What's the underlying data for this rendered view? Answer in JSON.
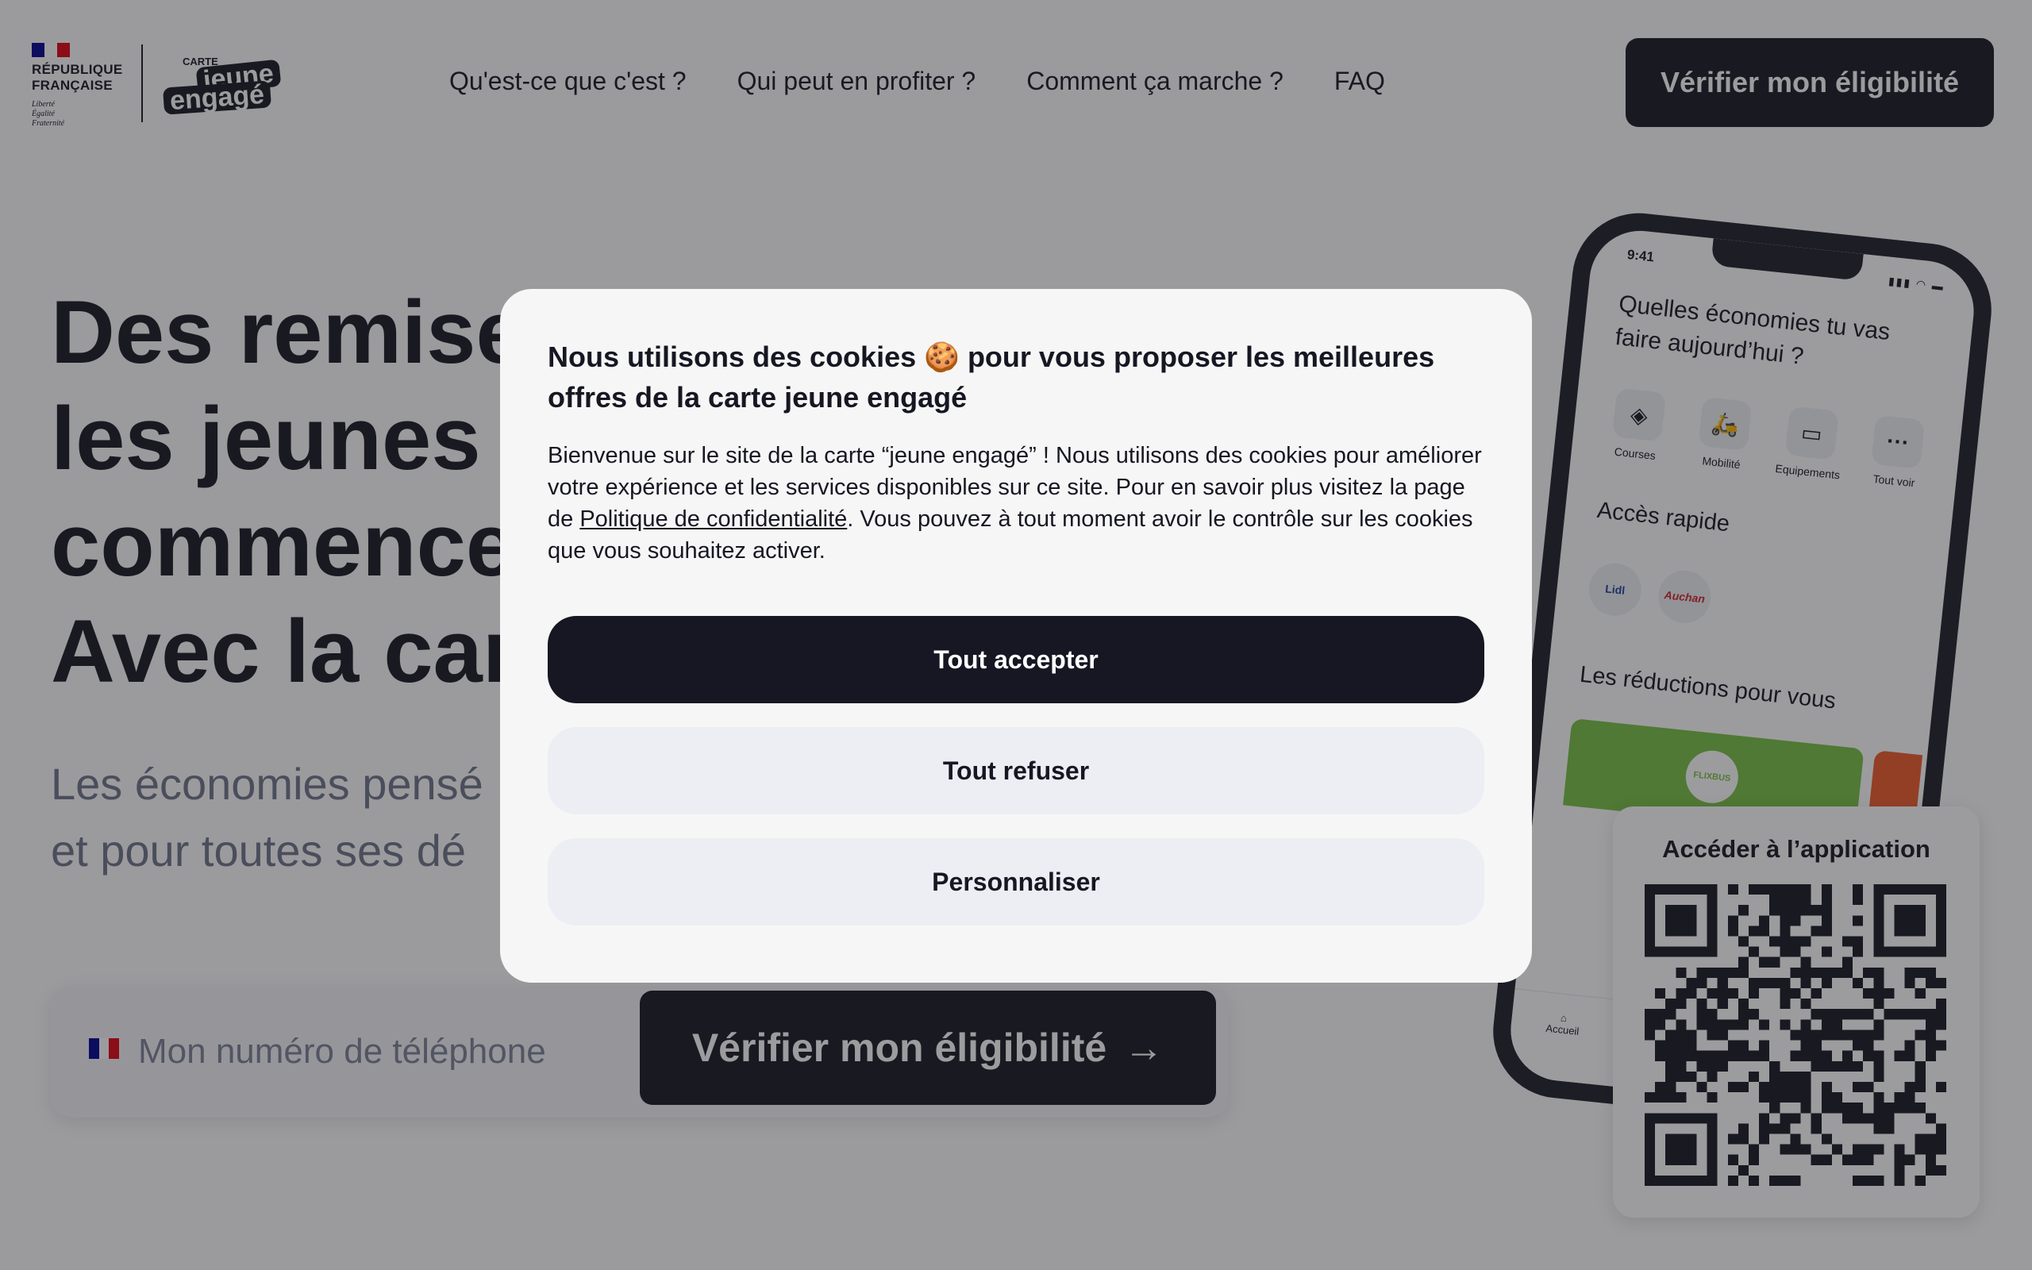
{
  "colors": {
    "primary_dark": "#161722",
    "flag_blue": "#000091",
    "flag_white": "#ffffff",
    "flag_red": "#e1000f"
  },
  "header": {
    "gov_name_line1": "RÉPUBLIQUE",
    "gov_name_line2": "FRANÇAISE",
    "gov_motto_line1": "Liberté",
    "gov_motto_line2": "Égalité",
    "gov_motto_line3": "Fraternité",
    "brand_small": "CARTE",
    "brand_word1": "jeune",
    "brand_word2": "engagé",
    "nav": [
      {
        "label": "Qu'est-ce que c'est ?"
      },
      {
        "label": "Qui peut en profiter ?"
      },
      {
        "label": "Comment ça marche ?"
      },
      {
        "label": "FAQ"
      }
    ],
    "cta_label": "Vérifier mon éligibilité"
  },
  "hero": {
    "title_line1": "Des remise",
    "title_line2": "les jeunes c",
    "title_line3": "commence",
    "title_line4": "Avec la car",
    "subtitle_line1": "Les économies pensé",
    "subtitle_line2": "et pour toutes ses dé",
    "phone_placeholder": "Mon numéro de téléphone",
    "cta_label": "Vérifier mon éligibilité",
    "cta_arrow": "→"
  },
  "phone_app": {
    "time": "9:41",
    "status": "▮▮▮ ◠ ▬",
    "title": "Quelles économies tu vas faire aujourd’hui ?",
    "categories": [
      {
        "label": "Courses",
        "icon": "◈"
      },
      {
        "label": "Mobilité",
        "icon": "🛵"
      },
      {
        "label": "Equipements",
        "icon": "▭"
      },
      {
        "label": "Tout voir",
        "icon": "···"
      }
    ],
    "quick_access_title": "Accès rapide",
    "quick_access": [
      "Lidl",
      "Auchan"
    ],
    "reductions_title": "Les réductions pour vous",
    "card_brand": "FLIXBUS",
    "nav_home": "Accueil"
  },
  "qr": {
    "title": "Accéder à l’application"
  },
  "cookie_modal": {
    "title": "Nous utilisons des cookies 🍪 pour vous proposer les meilleures offres de la carte jeune engagé",
    "body_before": "Bienvenue sur le site de la carte “jeune engagé” ! Nous utilisons des cookies pour améliorer votre expérience et les services disponibles sur ce site. Pour en savoir plus visitez la page de ",
    "body_link": "Politique de confidentialité",
    "body_after": ". Vous pouvez à tout moment avoir le contrôle sur les cookies que vous souhaitez activer.",
    "accept_label": "Tout accepter",
    "refuse_label": "Tout refuser",
    "customize_label": "Personnaliser"
  }
}
